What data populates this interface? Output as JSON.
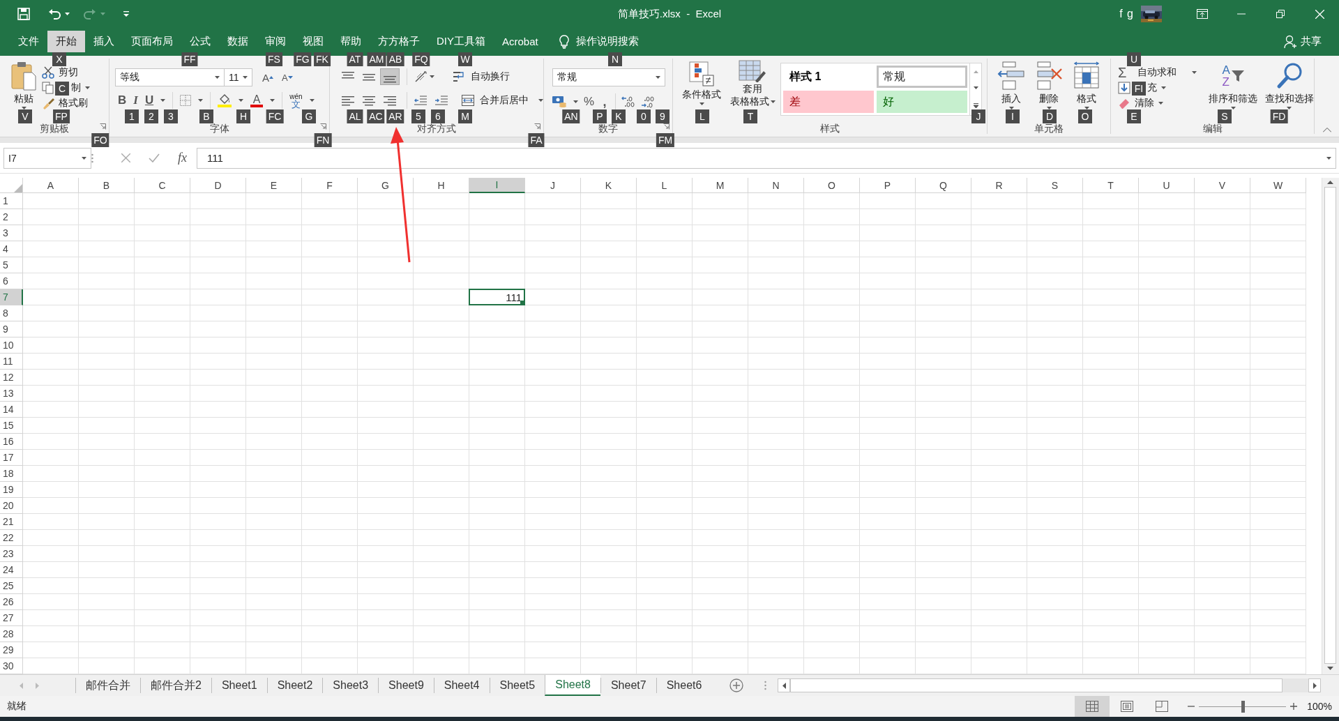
{
  "title_bar": {
    "title": "简单技巧.xlsx  -  Excel",
    "user": "f g"
  },
  "menu_tabs": [
    {
      "label": "文件",
      "selected": false
    },
    {
      "label": "开始",
      "selected": true
    },
    {
      "label": "插入",
      "selected": false
    },
    {
      "label": "页面布局",
      "selected": false
    },
    {
      "label": "公式",
      "selected": false
    },
    {
      "label": "数据",
      "selected": false
    },
    {
      "label": "审阅",
      "selected": false
    },
    {
      "label": "视图",
      "selected": false
    },
    {
      "label": "帮助",
      "selected": false
    },
    {
      "label": "方方格子",
      "selected": false
    },
    {
      "label": "DIY工具箱",
      "selected": false
    },
    {
      "label": "Acrobat",
      "selected": false
    }
  ],
  "tell_me": "操作说明搜索",
  "share": "共享",
  "ribbon": {
    "clipboard": {
      "label": "剪贴板",
      "paste": "粘贴",
      "cut": "剪切",
      "copy": "制",
      "format_painter": "格式刷"
    },
    "font": {
      "label": "字体",
      "font_name": "等线",
      "font_size": "11",
      "grow": "A",
      "shrink": "A",
      "bold": "B",
      "italic": "I",
      "underline": "U",
      "font_color": "A",
      "phonetic_top": "wén",
      "phonetic_bottom": "文"
    },
    "alignment": {
      "label": "对齐方式",
      "vertical": [
        {
          "kind": "top",
          "selected": false
        },
        {
          "kind": "middle",
          "selected": false
        },
        {
          "kind": "bottom",
          "selected": true
        }
      ],
      "wrap_text": "自动换行",
      "merge_center": "合并后居中"
    },
    "number": {
      "label": "数字",
      "format": "常规",
      "percent": "%",
      "comma": ","
    },
    "styles": {
      "label": "样式",
      "conditional": "条件格式",
      "table_line1": "套用",
      "table_line2": "表格格式",
      "gallery": [
        {
          "label": "样式 1",
          "kind": "custom",
          "selected": false
        },
        {
          "label": "常规",
          "kind": "normal",
          "selected": true
        },
        {
          "label": "差",
          "kind": "bad",
          "selected": false
        },
        {
          "label": "好",
          "kind": "good",
          "selected": false
        }
      ]
    },
    "cells": {
      "label": "单元格",
      "insert": "插入",
      "delete": "删除",
      "format": "格式"
    },
    "editing": {
      "label": "编辑",
      "sigma": "Σ",
      "autosum": "自动求和",
      "fill": "充",
      "clear": "清除",
      "sort_a": "A",
      "sort_z": "Z",
      "sort_filter": "排序和筛选",
      "find_select": "查找和选择"
    }
  },
  "key_tips": [
    "X",
    "FF",
    "FS",
    "FG",
    "FK",
    "AT",
    "AM",
    "AB",
    "FQ",
    "W",
    "N",
    "U",
    "C",
    "FI",
    "V",
    "FP",
    "1",
    "2",
    "3",
    "B",
    "H",
    "FC",
    "G",
    "AL",
    "AC",
    "AR",
    "5",
    "6",
    "M",
    "AN",
    "P",
    "K",
    "0",
    "9",
    "L",
    "T",
    "J",
    "I",
    "D",
    "O",
    "E",
    "S",
    "FD",
    "FO",
    "FN",
    "FA",
    "FM"
  ],
  "formula_bar": {
    "name_box": "I7",
    "fx": "fx",
    "value": "111"
  },
  "columns": [
    {
      "label": "A",
      "selected": false
    },
    {
      "label": "B",
      "selected": false
    },
    {
      "label": "C",
      "selected": false
    },
    {
      "label": "D",
      "selected": false
    },
    {
      "label": "E",
      "selected": false
    },
    {
      "label": "F",
      "selected": false
    },
    {
      "label": "G",
      "selected": false
    },
    {
      "label": "H",
      "selected": false
    },
    {
      "label": "I",
      "selected": true
    },
    {
      "label": "J",
      "selected": false
    },
    {
      "label": "K",
      "selected": false
    },
    {
      "label": "L",
      "selected": false
    },
    {
      "label": "M",
      "selected": false
    },
    {
      "label": "N",
      "selected": false
    },
    {
      "label": "O",
      "selected": false
    },
    {
      "label": "P",
      "selected": false
    },
    {
      "label": "Q",
      "selected": false
    },
    {
      "label": "R",
      "selected": false
    },
    {
      "label": "S",
      "selected": false
    },
    {
      "label": "T",
      "selected": false
    },
    {
      "label": "U",
      "selected": false
    },
    {
      "label": "V",
      "selected": false
    },
    {
      "label": "W",
      "selected": false
    }
  ],
  "rows": [
    {
      "label": "1",
      "selected": false
    },
    {
      "label": "2",
      "selected": false
    },
    {
      "label": "3",
      "selected": false
    },
    {
      "label": "4",
      "selected": false
    },
    {
      "label": "5",
      "selected": false
    },
    {
      "label": "6",
      "selected": false
    },
    {
      "label": "7",
      "selected": true
    },
    {
      "label": "8",
      "selected": false
    },
    {
      "label": "9",
      "selected": false
    },
    {
      "label": "10",
      "selected": false
    },
    {
      "label": "11",
      "selected": false
    },
    {
      "label": "12",
      "selected": false
    },
    {
      "label": "13",
      "selected": false
    },
    {
      "label": "14",
      "selected": false
    },
    {
      "label": "15",
      "selected": false
    },
    {
      "label": "16",
      "selected": false
    },
    {
      "label": "17",
      "selected": false
    },
    {
      "label": "18",
      "selected": false
    },
    {
      "label": "19",
      "selected": false
    },
    {
      "label": "20",
      "selected": false
    },
    {
      "label": "21",
      "selected": false
    },
    {
      "label": "22",
      "selected": false
    },
    {
      "label": "23",
      "selected": false
    },
    {
      "label": "24",
      "selected": false
    },
    {
      "label": "25",
      "selected": false
    },
    {
      "label": "26",
      "selected": false
    },
    {
      "label": "27",
      "selected": false
    },
    {
      "label": "28",
      "selected": false
    },
    {
      "label": "29",
      "selected": false
    },
    {
      "label": "30",
      "selected": false
    }
  ],
  "active_cell": {
    "value": "111"
  },
  "sheet_tabs": [
    {
      "label": "邮件合并",
      "selected": false
    },
    {
      "label": "邮件合并2",
      "selected": false
    },
    {
      "label": "Sheet1",
      "selected": false
    },
    {
      "label": "Sheet2",
      "selected": false
    },
    {
      "label": "Sheet3",
      "selected": false
    },
    {
      "label": "Sheet9",
      "selected": false
    },
    {
      "label": "Sheet4",
      "selected": false
    },
    {
      "label": "Sheet5",
      "selected": false
    },
    {
      "label": "Sheet8",
      "selected": true
    },
    {
      "label": "Sheet7",
      "selected": false
    },
    {
      "label": "Sheet6",
      "selected": false
    }
  ],
  "status_bar": {
    "status": "就绪",
    "views": [
      {
        "kind": "normal",
        "selected": true
      },
      {
        "kind": "page_layout",
        "selected": false
      },
      {
        "kind": "page_break",
        "selected": false
      }
    ],
    "zoom": {
      "level": 0.5
    },
    "zoom_text": "100%"
  }
}
